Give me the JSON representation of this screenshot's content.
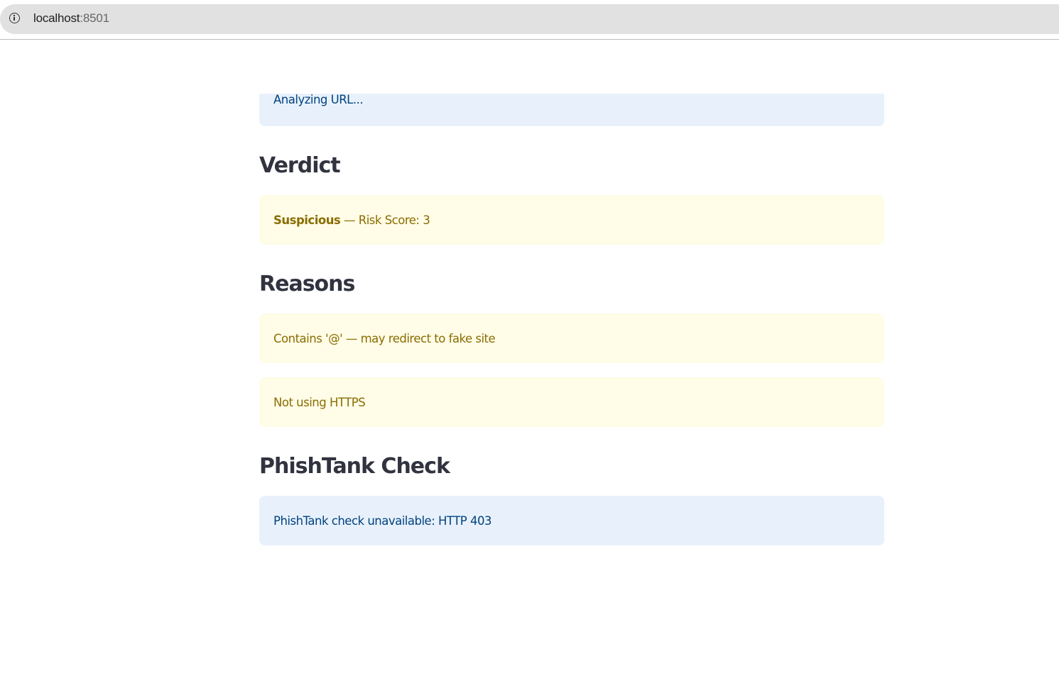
{
  "browser": {
    "host": "localhost",
    "port": ":8501"
  },
  "status": {
    "analyzing_text": "Analyzing URL..."
  },
  "verdict": {
    "heading": "Verdict",
    "label": "Suspicious",
    "detail": " — Risk Score: 3"
  },
  "reasons": {
    "heading": "Reasons",
    "items": [
      "Contains '@' — may redirect to fake site",
      "Not using HTTPS"
    ]
  },
  "phishtank": {
    "heading": "PhishTank Check",
    "message": "PhishTank check unavailable: HTTP 403"
  },
  "colors": {
    "info_bg": "#e8f1fb",
    "info_text": "#004280",
    "warn_bg": "#fffce7",
    "warn_text": "#8a6d00",
    "heading_text": "#31333f"
  },
  "icons": {
    "address_bar": "info-circle-icon"
  }
}
